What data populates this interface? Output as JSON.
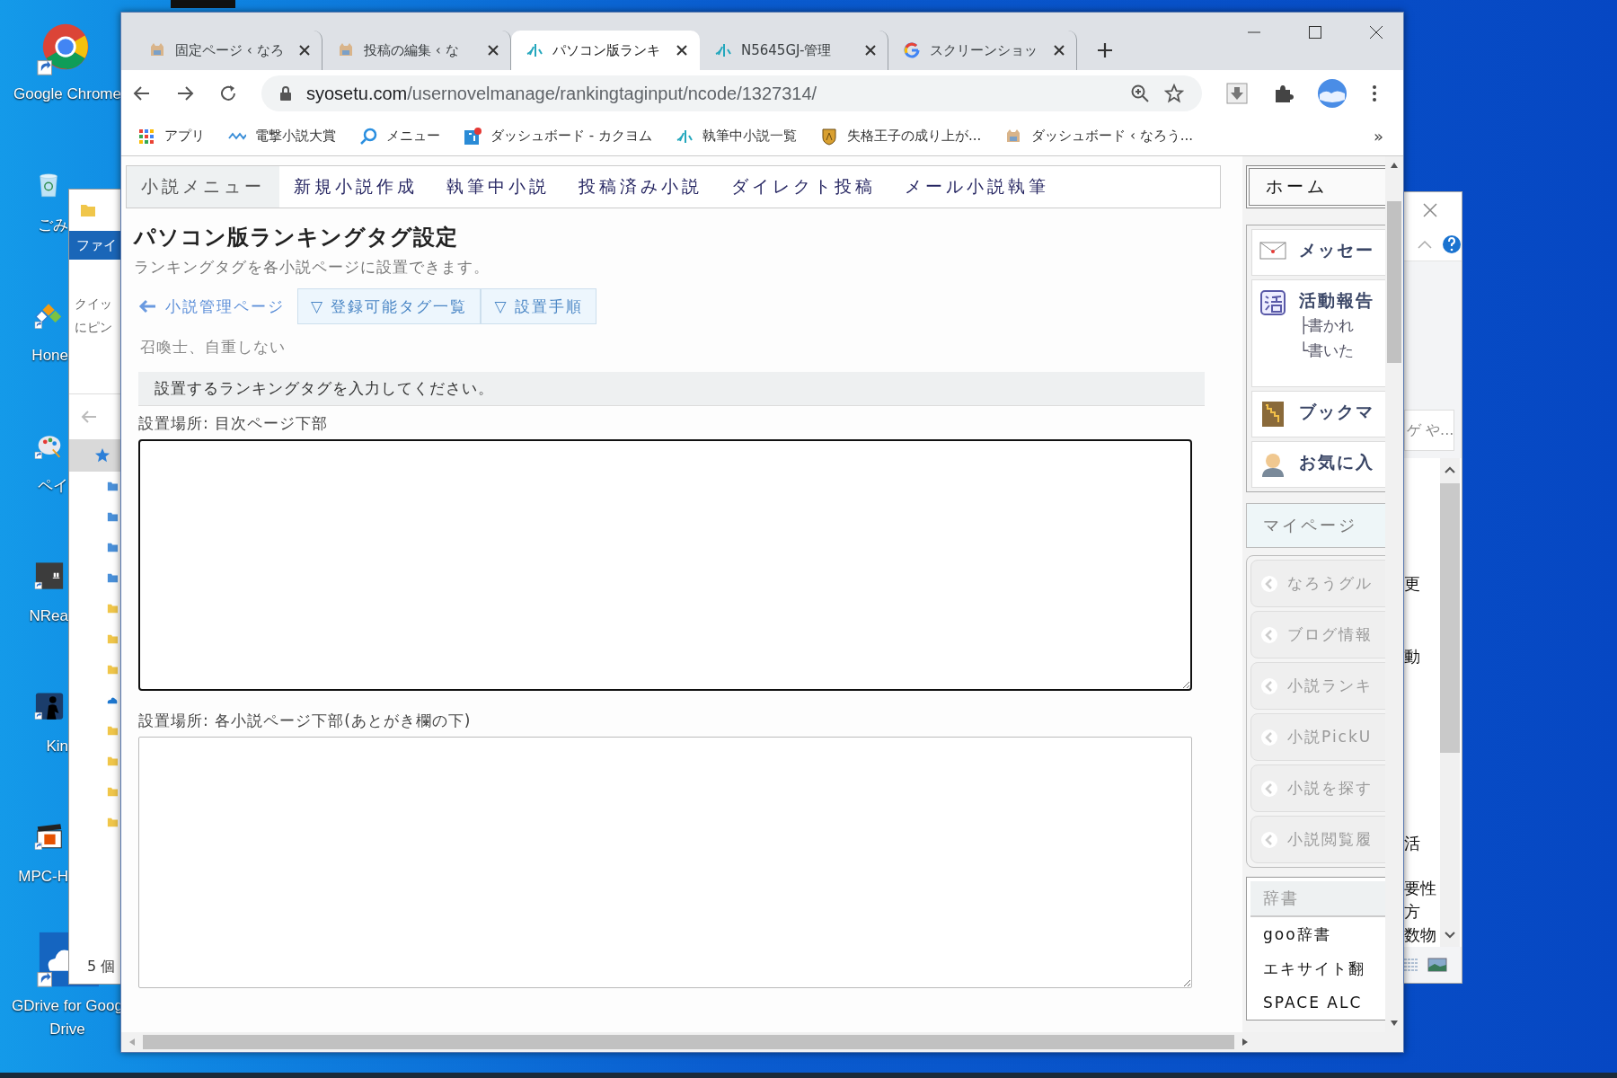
{
  "desktop": {
    "icons": [
      {
        "label": "Google Chrome",
        "kind": "chrome"
      },
      {
        "label": "ごみ",
        "kind": "trash"
      },
      {
        "label": "Hone",
        "kind": "diamond"
      },
      {
        "label": "ペイ",
        "kind": "palette"
      },
      {
        "label": "NRea",
        "kind": "dark"
      },
      {
        "label": "Kin",
        "kind": "reader"
      },
      {
        "label": "MPC-H",
        "kind": "clapper"
      },
      {
        "label": "GDrive for Goog\nDrive",
        "kind": "gdrive"
      }
    ]
  },
  "explorer_window": {
    "ribbon_tab": "ファイ",
    "pin_hint": [
      "クイッ",
      "にピン"
    ],
    "status": "5 個"
  },
  "back_window": {
    "search_text": "ゲ や...",
    "fragments": [
      "更",
      "動",
      "活",
      "要性",
      "方",
      "数物"
    ]
  },
  "browser": {
    "tabs": [
      {
        "title": "固定ページ ‹ なろ",
        "kind": "cat",
        "selected": false
      },
      {
        "title": "投稿の編集 ‹ な",
        "kind": "cat",
        "selected": false
      },
      {
        "title": "パソコン版ランキ",
        "kind": "script",
        "selected": true
      },
      {
        "title": "N5645GJ-管理",
        "kind": "script",
        "selected": false
      },
      {
        "title": "スクリーンショッ",
        "kind": "google",
        "selected": false
      }
    ],
    "address": {
      "host": "syosetu.com",
      "path": "/usernovelmanage/rankingtaginput/ncode/1327314/"
    },
    "bookmarks": [
      {
        "label": "アプリ",
        "kind": "apps"
      },
      {
        "label": "電撃小説大賞",
        "kind": "wave"
      },
      {
        "label": "メニュー",
        "kind": "search"
      },
      {
        "label": "ダッシュボード - カクヨム",
        "kind": "bracket"
      },
      {
        "label": "執筆中小説一覧",
        "kind": "script"
      },
      {
        "label": "失格王子の成り上が...",
        "kind": "shield"
      },
      {
        "label": "ダッシュボード ‹ なろう...",
        "kind": "cat"
      }
    ],
    "bookmarks_overflow": "»"
  },
  "page": {
    "nav": [
      {
        "label": "小説メニュー",
        "selected": true
      },
      {
        "label": "新規小説作成",
        "selected": false
      },
      {
        "label": "執筆中小説",
        "selected": false
      },
      {
        "label": "投稿済み小説",
        "selected": false
      },
      {
        "label": "ダイレクト投稿",
        "selected": false
      },
      {
        "label": "メール小説執筆",
        "selected": false
      }
    ],
    "title": "パソコン版ランキングタグ設定",
    "subtitle": "ランキングタグを各小説ページに設置できます。",
    "back_link": "小説管理ページ",
    "toggles": [
      "▽ 登録可能タグ一覧",
      "▽ 設置手順"
    ],
    "novel_title": "召喚士、自重しない",
    "notice": "設置するランキングタグを入力してください。",
    "fields": [
      {
        "label": "設置場所: 目次ページ下部",
        "focused": true
      },
      {
        "label": "設置場所: 各小説ページ下部(あとがき欄の下)",
        "focused": false
      }
    ],
    "sidebar": {
      "home": "ホーム",
      "panel": [
        {
          "label": "メッセー",
          "kind": "mail"
        },
        {
          "label": "活動報告",
          "kind": "katsu",
          "sub": [
            "├書かれ",
            "└書いた"
          ]
        },
        {
          "label": "ブックマ",
          "kind": "book"
        },
        {
          "label": "お気に入",
          "kind": "person"
        }
      ],
      "mypage": "マイページ",
      "links": [
        "なろうグル",
        "ブログ情報",
        "小説ランキ",
        "小説PickU",
        "小説を探す",
        "小説閲覧履"
      ],
      "dictionary": {
        "header": "辞書",
        "items": [
          "goo辞書",
          "エキサイト翻",
          "SPACE ALC"
        ]
      }
    }
  }
}
